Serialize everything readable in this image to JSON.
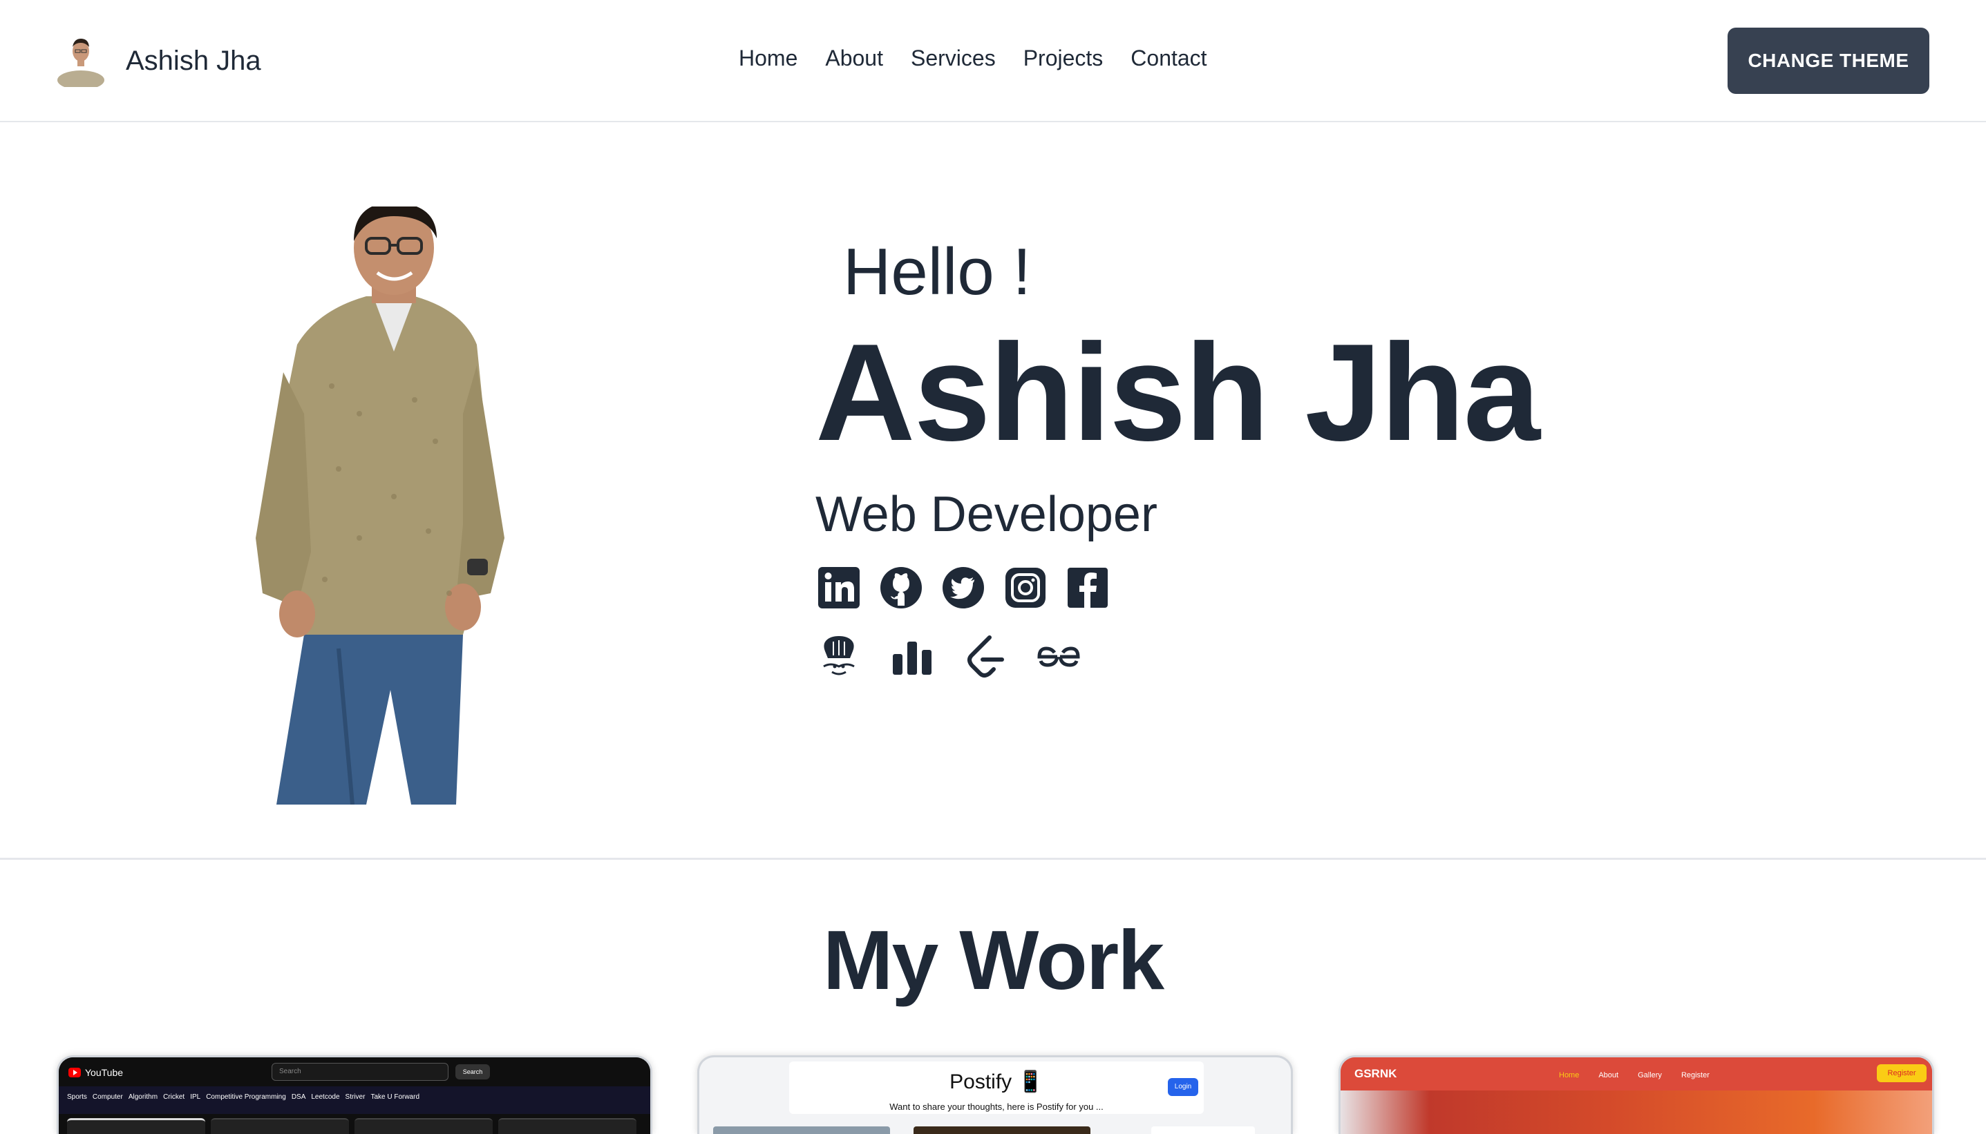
{
  "nav": {
    "brand_name": "Ashish Jha",
    "links": [
      "Home",
      "About",
      "Services",
      "Projects",
      "Contact"
    ],
    "theme_button": "CHANGE THEME"
  },
  "hero": {
    "greeting": "Hello !",
    "name": "Ashish Jha",
    "role": "Web Developer",
    "social_icons": [
      "linkedin-icon",
      "github-icon",
      "twitter-icon",
      "instagram-icon",
      "facebook-icon"
    ],
    "coding_icons": [
      "codechef-icon",
      "codeforces-icon",
      "leetcode-icon",
      "geeksforgeeks-icon"
    ]
  },
  "work": {
    "title": "My Work",
    "projects": [
      {
        "name": "YouTube",
        "search_placeholder": "Search",
        "search_button": "Search",
        "chips": [
          "Sports",
          "Computer",
          "Algorithm",
          "Cricket",
          "IPL",
          "Competitive Programming",
          "DSA",
          "Leetcode",
          "Striver",
          "Take U Forward"
        ]
      },
      {
        "name": "Postify 📱",
        "subtitle": "Want to share your thoughts, here is Postify for you ...",
        "login": "Login"
      },
      {
        "name": "GSRNK",
        "links": [
          "Home",
          "About",
          "Gallery",
          "Register"
        ],
        "register": "Register"
      }
    ]
  },
  "colors": {
    "text": "#1f2937",
    "button_bg": "#374151",
    "divider": "#e5e7eb"
  }
}
